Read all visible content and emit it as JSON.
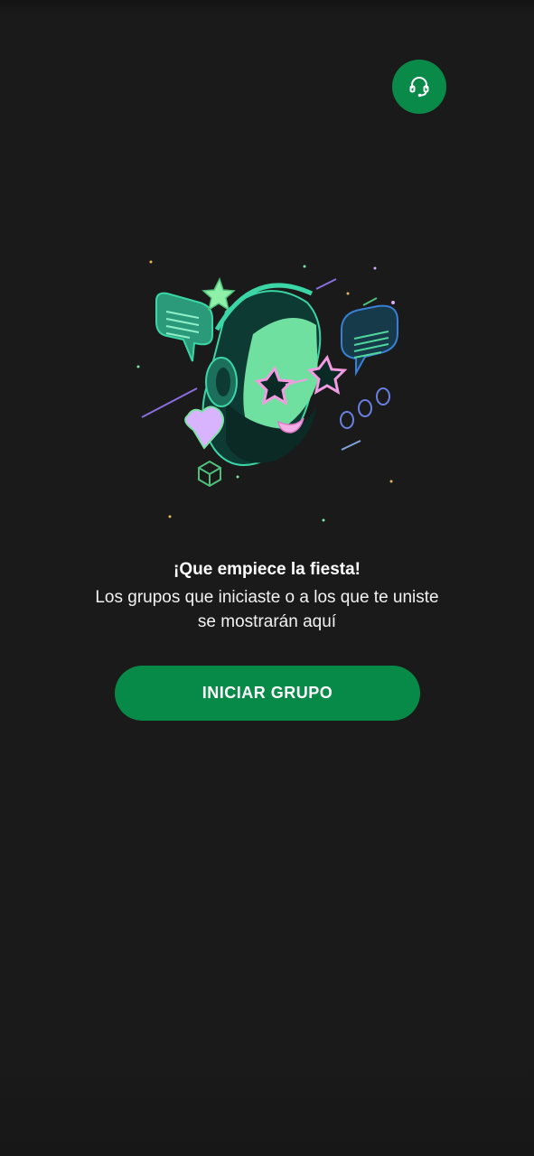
{
  "header": {
    "support_icon": "headset-icon",
    "accent_color": "#0a8a48"
  },
  "empty_state": {
    "illustration": "party-dj-character-illustration",
    "title": "¡Que empiece la fiesta!",
    "message": "Los grupos que iniciaste o a los que te uniste se mostrarán aquí"
  },
  "actions": {
    "start_group_label": "INICIAR GRUPO"
  },
  "colors": {
    "background": "#1a1a1a",
    "primary_green": "#078a47",
    "text_primary": "#ffffff"
  }
}
